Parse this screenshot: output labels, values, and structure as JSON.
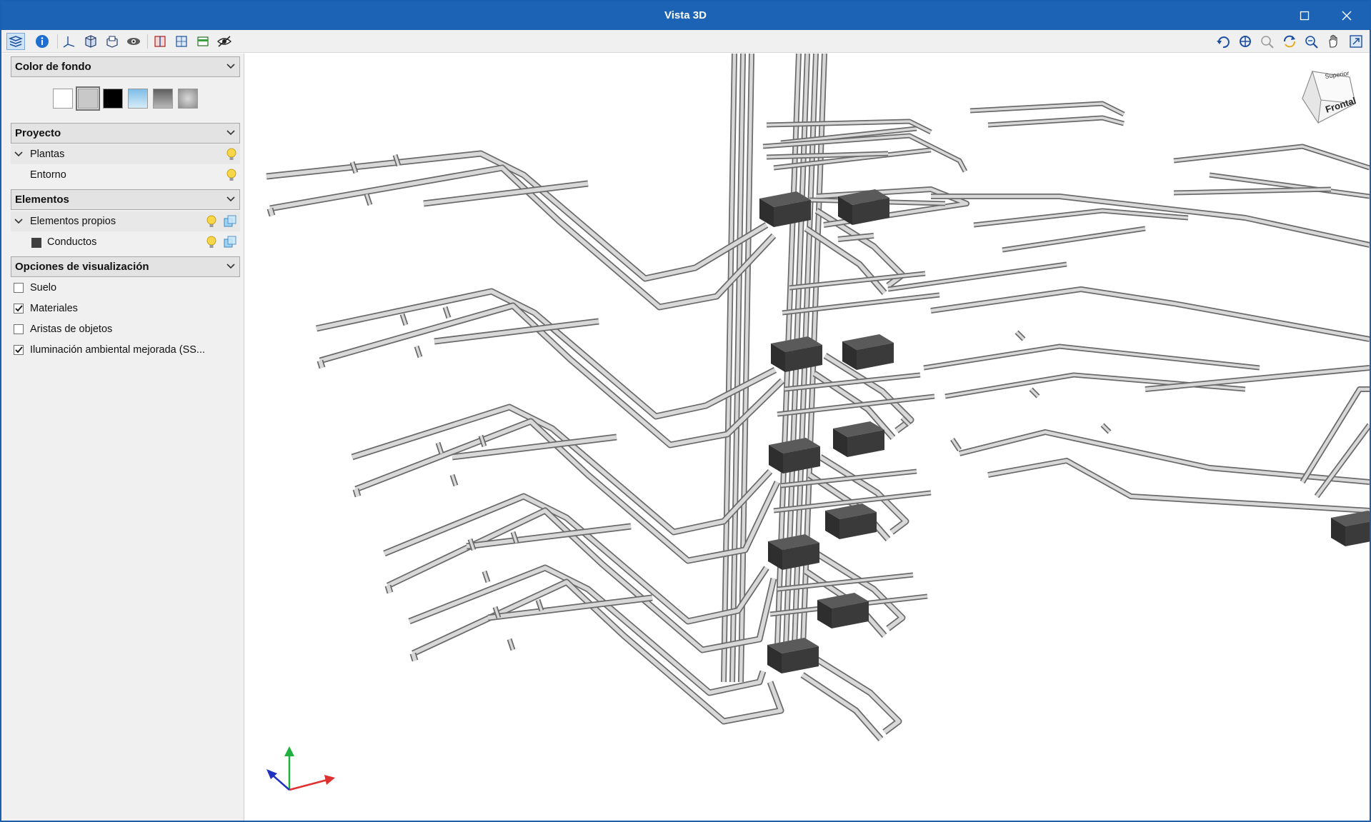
{
  "window": {
    "title": "Vista 3D"
  },
  "sidebar": {
    "background_section": {
      "label": "Color de fondo",
      "swatches": [
        "#ffffff",
        "#c8c8c8",
        "#000000",
        "#a9d4f0",
        "#8a8a8a",
        "#a4a4a4"
      ],
      "selected_index": 1
    },
    "project_section": {
      "label": "Proyecto",
      "items": [
        {
          "label": "Plantas",
          "expanded": true
        },
        {
          "label": "Entorno"
        }
      ]
    },
    "elements_section": {
      "label": "Elementos",
      "items": [
        {
          "label": "Elementos propios",
          "expanded": true
        },
        {
          "label": "Conductos",
          "swatch": "#404040"
        }
      ]
    },
    "display_section": {
      "label": "Opciones de visualización",
      "options": [
        {
          "label": "Suelo",
          "checked": false
        },
        {
          "label": "Materiales",
          "checked": true
        },
        {
          "label": "Aristas de objetos",
          "checked": false
        },
        {
          "label": "Iluminación ambiental mejorada (SS...",
          "checked": true
        }
      ]
    }
  },
  "viewcube": {
    "top_label": "Superior",
    "front_label": "Frontal"
  },
  "colors": {
    "titlebar": "#1c63b6",
    "duct_fill": "#d8d8d8",
    "duct_edge": "#6a6a6a",
    "box": "#3a3a3a",
    "axis_x": "#e03030",
    "axis_y": "#20b040",
    "axis_z": "#2030c0"
  }
}
